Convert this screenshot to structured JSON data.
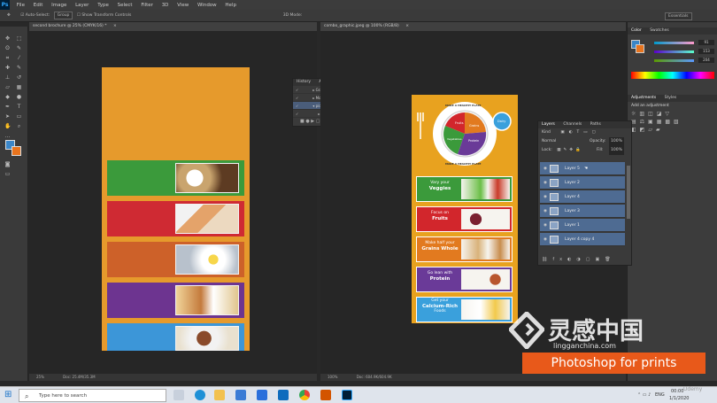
{
  "app": {
    "logo": "Ps"
  },
  "menu": [
    "File",
    "Edit",
    "Image",
    "Layer",
    "Type",
    "Select",
    "Filter",
    "3D",
    "View",
    "Window",
    "Help"
  ],
  "options": {
    "auto_select": "Auto-Select:",
    "auto_select_value": "Group",
    "show_transform": "Show Transform Controls",
    "mode_3d": "3D Mode:",
    "workspace": "Essentials"
  },
  "docs": {
    "left_tab": "second brochure @ 25% (CMYK/16) *",
    "left_zoom": "25%",
    "left_doc": "Doc: 25.4M/35.3M",
    "right_tab": "combo_graphic.jpeg @ 100% (RGB/8)",
    "right_zoom": "100%",
    "right_doc": "Doc: 604.9K/604.9K"
  },
  "color_panel": {
    "tab_color": "Color",
    "tab_swatches": "Swatches",
    "r": "91",
    "g": "153",
    "b": "204"
  },
  "adjustments": {
    "tab_adjustments": "Adjustments",
    "tab_styles": "Styles",
    "heading": "Add an adjustment"
  },
  "actions": {
    "tab_history": "History",
    "tab_actions": "Actions",
    "rows": [
      "Gradient Map",
      "Move Brush Closing...",
      "pic size",
      "Image Size"
    ],
    "badge": "F2"
  },
  "layers": {
    "tab_layers": "Layers",
    "tab_channels": "Channels",
    "tab_paths": "Paths",
    "kind": "Kind",
    "blend": "Normal",
    "opacity_label": "Opacity:",
    "opacity": "100%",
    "lock_label": "Lock:",
    "fill_label": "Fill:",
    "fill": "100%",
    "items": [
      "Layer 5",
      "Layer 2",
      "Layer 4",
      "Layer 3",
      "Layer 1",
      "Layer 4 copy 4"
    ]
  },
  "art_right": {
    "bands": [
      {
        "line1": "Vary your",
        "line2": "Veggies",
        "color": "#3b9a3b"
      },
      {
        "line1": "Focus on",
        "line2": "Fruits",
        "color": "#d2262c"
      },
      {
        "line1": "Make half your",
        "line2": "Grains Whole",
        "color": "#e27a1f"
      },
      {
        "line1": "Go lean with",
        "line2": "Protein",
        "color": "#6a3a98"
      },
      {
        "line1": "Get your",
        "line2": "Calcium-Rich",
        "line3": "Foods",
        "color": "#3aa0dc"
      }
    ],
    "plate": {
      "fruits": "Fruits",
      "grains": "Grains",
      "vegetables": "Vegetables",
      "protein": "Protein",
      "dairy": "Dairy",
      "rim_top": "MAKE A HEALTHY PLATE",
      "rim_bottom": "MAKE A HEALTHY PLATE"
    }
  },
  "art_left": {
    "bands": [
      "#3b9a3b",
      "#cf2a33",
      "#cd6129",
      "#6d3490",
      "#3c96d8"
    ],
    "background": "#e69a2c"
  },
  "taskbar": {
    "search": "Type here to search",
    "lang": "ENG",
    "time": "00:00",
    "date": "1/1/2020"
  },
  "watermark": {
    "brand": "灵感中国",
    "url": "lingganchina.com",
    "course": "Photoshop for prints",
    "udemy": "Udemy"
  },
  "colors": {
    "fg": "#3a86c8",
    "bg": "#e8741e",
    "layer_sel": "#4e6b92"
  }
}
